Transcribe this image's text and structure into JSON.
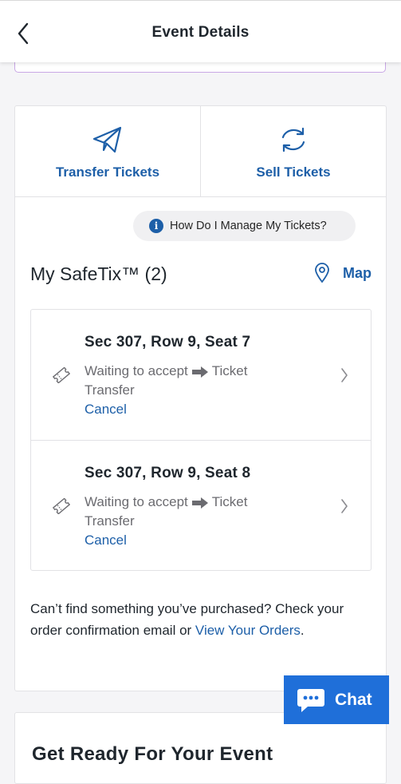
{
  "header": {
    "title": "Event Details"
  },
  "actions": [
    {
      "label": "Transfer Tickets",
      "icon": "paper-plane-icon"
    },
    {
      "label": "Sell Tickets",
      "icon": "refresh-icon"
    }
  ],
  "help": {
    "label": "How Do I Manage My Tickets?",
    "icon": "info-icon"
  },
  "safetix": {
    "title": "My SafeTix™ (2)",
    "map_label": "Map"
  },
  "tickets": [
    {
      "seat": "Sec 307, Row 9, Seat 7",
      "status_before": "Waiting to accept",
      "status_after": "Ticket Transfer",
      "cancel": "Cancel"
    },
    {
      "seat": "Sec 307, Row 9, Seat 8",
      "status_before": "Waiting to accept",
      "status_after": "Ticket Transfer",
      "cancel": "Cancel"
    }
  ],
  "footnote": {
    "text": "Can’t find something you’ve purchased? Check your order confirmation email or ",
    "link": "View Your Orders",
    "end": "."
  },
  "section2": {
    "title": "Get Ready For Your Event"
  },
  "chat": {
    "label": "Chat"
  },
  "colors": {
    "accent": "#1d5fa8",
    "chat": "#1f6fd9",
    "purple_border": "#c9a7e6"
  }
}
